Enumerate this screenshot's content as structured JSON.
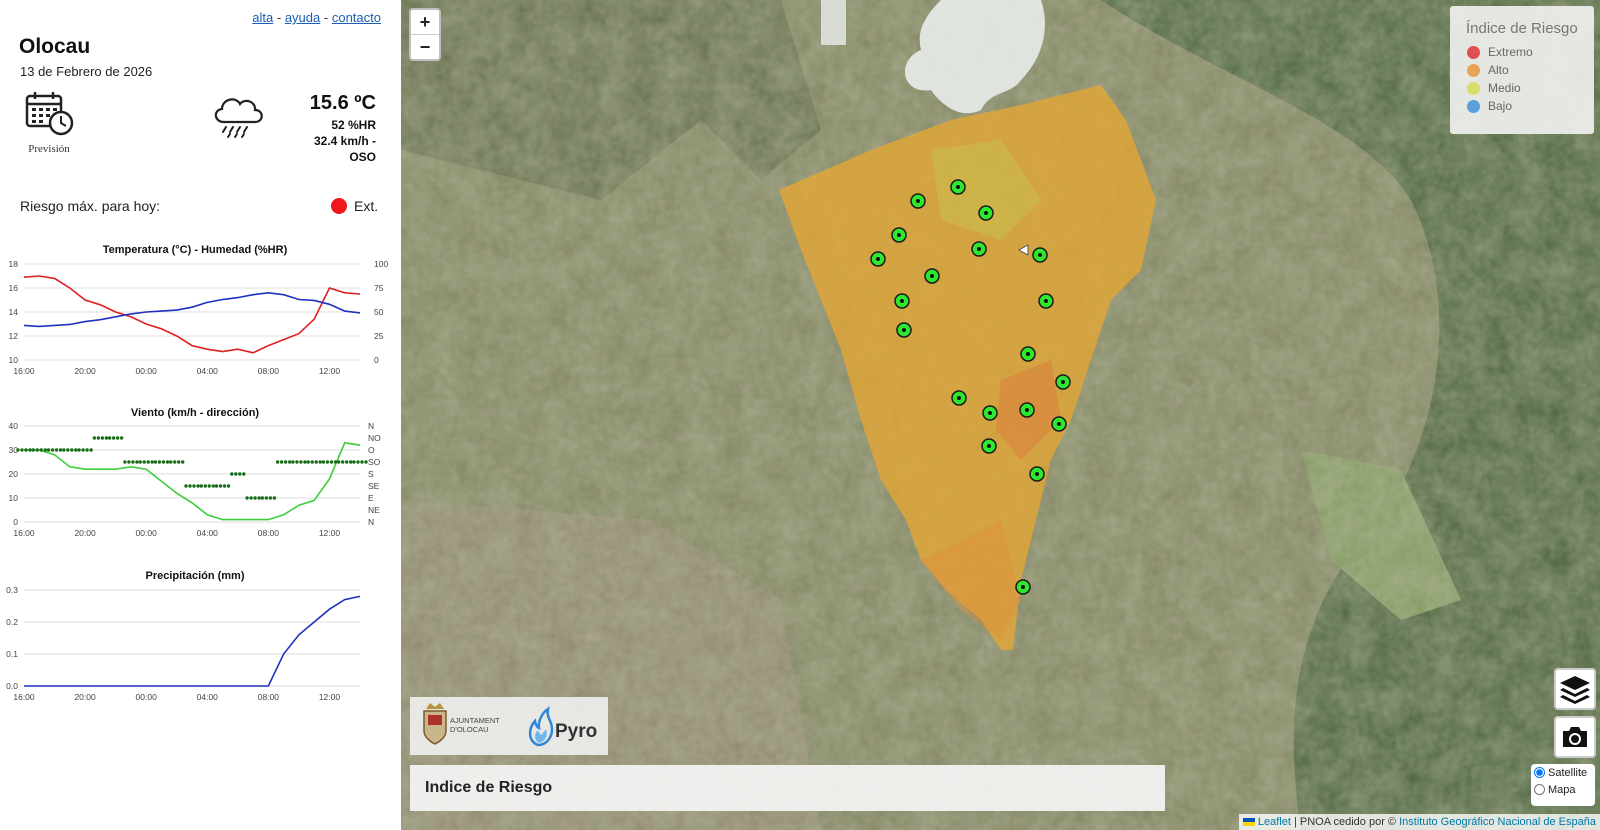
{
  "header": {
    "links": [
      {
        "label": "alta"
      },
      {
        "label": "ayuda"
      },
      {
        "label": "contacto"
      }
    ],
    "separator": "-"
  },
  "location": {
    "name": "Olocau",
    "date": "13 de Febrero de 2026"
  },
  "forecast": {
    "label": "Previsión"
  },
  "current": {
    "temperature": "15.6 ºC",
    "humidity": "52 %HR",
    "wind_line1": "32.4 km/h -",
    "wind_line2": "OSO"
  },
  "risk": {
    "label": "Riesgo máx. para hoy:",
    "value": "Ext.",
    "color": "#f01818"
  },
  "map": {
    "zoom_in": "+",
    "zoom_out": "−",
    "legend": {
      "title": "Índice de Riesgo",
      "items": [
        {
          "label": "Extremo",
          "color": "#e05050"
        },
        {
          "label": "Alto",
          "color": "#e8a25a"
        },
        {
          "label": "Medio",
          "color": "#d9dd6a"
        },
        {
          "label": "Bajo",
          "color": "#5a9fd8"
        }
      ]
    },
    "logos": {
      "ayuntamiento": "AJUNTAMENT D'OLOCAU",
      "pyro": "Pyro"
    },
    "title": "Indice de Riesgo",
    "basemap": {
      "options": [
        "Satellite",
        "Mapa"
      ],
      "selected": "Satellite"
    },
    "attribution": {
      "leaflet": "Leaflet",
      "sep": " | PNOA cedido por © ",
      "ign": "Instituto Geográfico Nacional de España"
    }
  },
  "chart_data": [
    {
      "type": "line",
      "title": "Temperatura (°C) - Humedad (%HR)",
      "x": [
        "16:00",
        "17:00",
        "18:00",
        "19:00",
        "20:00",
        "21:00",
        "22:00",
        "23:00",
        "00:00",
        "01:00",
        "02:00",
        "03:00",
        "04:00",
        "05:00",
        "06:00",
        "07:00",
        "08:00",
        "09:00",
        "10:00",
        "11:00",
        "12:00",
        "13:00",
        "14:00"
      ],
      "xticks": [
        "16:00",
        "20:00",
        "00:00",
        "04:00",
        "08:00",
        "12:00"
      ],
      "y_left": {
        "ticks": [
          10,
          12,
          14,
          16,
          18
        ],
        "range": [
          10,
          18
        ]
      },
      "y_right": {
        "ticks": [
          0,
          25,
          50,
          75,
          100
        ],
        "range": [
          0,
          100
        ]
      },
      "series": [
        {
          "axis": "left",
          "color": "#e02020",
          "values": [
            16.9,
            17.0,
            16.8,
            16.0,
            15.0,
            14.6,
            14.0,
            13.6,
            13.0,
            12.6,
            12.0,
            11.2,
            10.9,
            10.7,
            10.9,
            10.6,
            11.2,
            11.7,
            12.2,
            13.4,
            16.0,
            15.6,
            15.5
          ]
        },
        {
          "axis": "right",
          "color": "#2030c0",
          "values": [
            36,
            35,
            36,
            37,
            40,
            42,
            45,
            48,
            50,
            51,
            52,
            55,
            60,
            63,
            65,
            68,
            70,
            68,
            63,
            62,
            58,
            51,
            49
          ]
        }
      ]
    },
    {
      "type": "line",
      "title": "Viento (km/h - dirección)",
      "x": [
        "16:00",
        "17:00",
        "18:00",
        "19:00",
        "20:00",
        "21:00",
        "22:00",
        "23:00",
        "00:00",
        "01:00",
        "02:00",
        "03:00",
        "04:00",
        "05:00",
        "06:00",
        "07:00",
        "08:00",
        "09:00",
        "10:00",
        "11:00",
        "12:00",
        "13:00",
        "14:00"
      ],
      "xticks": [
        "16:00",
        "20:00",
        "00:00",
        "04:00",
        "08:00",
        "12:00"
      ],
      "y_left": {
        "ticks": [
          0,
          10,
          20,
          30,
          40
        ],
        "range": [
          0,
          40
        ]
      },
      "y_right": {
        "ticks": [
          "N",
          "NE",
          "E",
          "SE",
          "S",
          "SO",
          "O",
          "NO",
          "N"
        ]
      },
      "series": [
        {
          "name": "speed",
          "color": "#39d039",
          "values": [
            30,
            30,
            28,
            23,
            22,
            22,
            22,
            23,
            22,
            17,
            12,
            8,
            3,
            1,
            1,
            1,
            1,
            3,
            7,
            9,
            18,
            33,
            32
          ]
        },
        {
          "name": "direction",
          "color": "#1a6e1a",
          "style": "dots",
          "values": [
            "O",
            "O",
            "O",
            "O",
            "O",
            "NO",
            "NO",
            "SO",
            "SO",
            "SO",
            "SO",
            "SE",
            "SE",
            "SE",
            "S",
            "E",
            "E",
            "SO",
            "SO",
            "SO",
            "SO",
            "SO",
            "SO"
          ]
        }
      ]
    },
    {
      "type": "line",
      "title": "Precipitación (mm)",
      "x": [
        "16:00",
        "17:00",
        "18:00",
        "19:00",
        "20:00",
        "21:00",
        "22:00",
        "23:00",
        "00:00",
        "01:00",
        "02:00",
        "03:00",
        "04:00",
        "05:00",
        "06:00",
        "07:00",
        "08:00",
        "09:00",
        "10:00",
        "11:00",
        "12:00",
        "13:00",
        "14:00"
      ],
      "xticks": [
        "16:00",
        "20:00",
        "00:00",
        "04:00",
        "08:00",
        "12:00"
      ],
      "y_left": {
        "ticks": [
          0.0,
          0.1,
          0.2,
          0.3
        ],
        "range": [
          0,
          0.3
        ]
      },
      "series": [
        {
          "color": "#2030c0",
          "values": [
            0,
            0,
            0,
            0,
            0,
            0,
            0,
            0,
            0,
            0,
            0,
            0,
            0,
            0,
            0,
            0,
            0,
            0.1,
            0.16,
            0.2,
            0.24,
            0.27,
            0.28
          ]
        }
      ]
    }
  ]
}
